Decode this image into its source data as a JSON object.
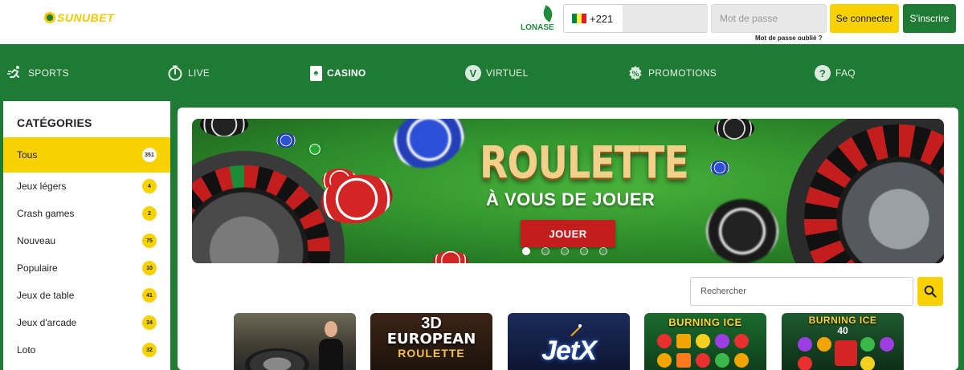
{
  "header": {
    "logo_text": "SUNUBET",
    "partner_logo_text": "LONASE",
    "phone_prefix": "+221",
    "phone_value": "",
    "password_placeholder": "Mot de passe",
    "forgot_password": "Mot de passe oublié ?",
    "login_label": "Se connecter",
    "signup_label": "S'inscrire"
  },
  "nav": {
    "items": [
      {
        "label": "SPORTS",
        "icon": "runner-icon"
      },
      {
        "label": "LIVE",
        "icon": "stopwatch-icon"
      },
      {
        "label": "CASINO",
        "icon": "playing-card-icon",
        "active": true
      },
      {
        "label": "VIRTUEL",
        "icon": "v-circle-icon"
      },
      {
        "label": "PROMOTIONS",
        "icon": "percent-badge-icon"
      },
      {
        "label": "FAQ",
        "icon": "question-circle-icon"
      }
    ]
  },
  "sidebar": {
    "title": "CATÉGORIES",
    "items": [
      {
        "label": "Tous",
        "count": "351",
        "active": true
      },
      {
        "label": "Jeux légers",
        "count": "4"
      },
      {
        "label": "Crash games",
        "count": "2"
      },
      {
        "label": "Nouveau",
        "count": "75"
      },
      {
        "label": "Populaire",
        "count": "10"
      },
      {
        "label": "Jeux de table",
        "count": "41"
      },
      {
        "label": "Jeux d'arcade",
        "count": "34"
      },
      {
        "label": "Loto",
        "count": "32"
      }
    ]
  },
  "banner": {
    "title": "ROULETTE",
    "subtitle": "À VOUS DE JOUER",
    "button_label": "JOUER",
    "slides_total": 5,
    "active_slide": 1
  },
  "search": {
    "placeholder": "Rechercher"
  },
  "games": [
    {
      "name": "live-roulette"
    },
    {
      "name": "3d-european-roulette",
      "line1": "3D",
      "line2": "EUROPEAN",
      "line3": "ROULETTE"
    },
    {
      "name": "jetx",
      "text": "JetX"
    },
    {
      "name": "burning-ice",
      "title": "BURNING ICE"
    },
    {
      "name": "burning-ice-40",
      "title": "BURNING ICE",
      "sub": "40"
    }
  ],
  "colors": {
    "brand_green": "#1f7a33",
    "accent_yellow": "#f7d200",
    "banner_red": "#c41d1d"
  }
}
